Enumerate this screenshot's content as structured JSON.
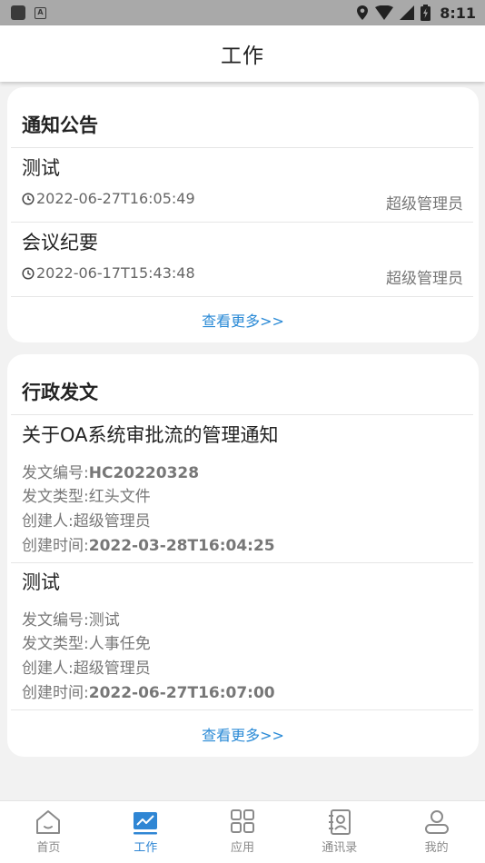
{
  "status_bar": {
    "time": "8:11",
    "notification_icon": "A"
  },
  "header": {
    "title": "工作"
  },
  "notice": {
    "title": "通知公告",
    "items": [
      {
        "title": "测试",
        "time": "2022-06-27T16:05:49",
        "author": "超级管理员"
      },
      {
        "title": "会议纪要",
        "time": "2022-06-17T15:43:48",
        "author": "超级管理员"
      }
    ],
    "more": "查看更多>>"
  },
  "docs": {
    "title": "行政发文",
    "items": [
      {
        "title": "关于OA系统审批流的管理通知",
        "number_label": "发文编号:",
        "number": "HC20220328",
        "type_label": "发文类型:",
        "type": "红头文件",
        "creator_label": "创建人:",
        "creator": "超级管理员",
        "created_label": "创建时间:",
        "created": "2022-03-28T16:04:25"
      },
      {
        "title": "测试",
        "number_label": "发文编号:",
        "number": "测试",
        "type_label": "发文类型:",
        "type": "人事任免",
        "creator_label": "创建人:",
        "creator": "超级管理员",
        "created_label": "创建时间:",
        "created": "2022-06-27T16:07:00"
      }
    ],
    "more": "查看更多>>"
  },
  "nav": [
    {
      "label": "首页",
      "icon": "home-icon",
      "active": false
    },
    {
      "label": "工作",
      "icon": "work-chart-icon",
      "active": true
    },
    {
      "label": "应用",
      "icon": "apps-grid-icon",
      "active": false
    },
    {
      "label": "通讯录",
      "icon": "contacts-icon",
      "active": false
    },
    {
      "label": "我的",
      "icon": "profile-icon",
      "active": false
    }
  ],
  "colors": {
    "accent": "#2f86d4",
    "link": "#2a8ad6",
    "background": "#f2f2f2"
  }
}
